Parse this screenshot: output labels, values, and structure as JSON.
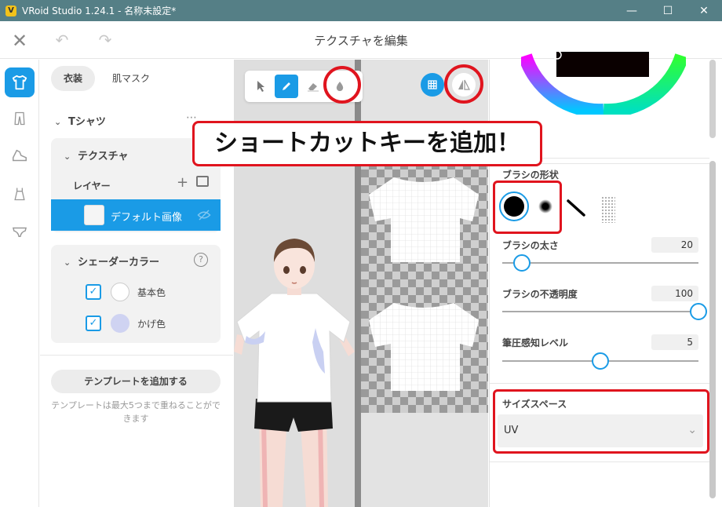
{
  "window": {
    "title": "VRoid Studio 1.24.1 - 名称未設定*",
    "logo_letter": "V",
    "controls": {
      "minimize": "—",
      "maximize": "☐",
      "close": "✕"
    }
  },
  "header": {
    "close": "✕",
    "undo": "↶",
    "redo": "↷",
    "title": "テクスチャを編集"
  },
  "rail": {
    "items": [
      "shirt-icon",
      "pants-icon",
      "shoe-icon",
      "dress-icon",
      "underwear-icon"
    ]
  },
  "left_panel": {
    "tabs": [
      "衣装",
      "肌マスク"
    ],
    "section_title": "Tシャツ",
    "texture_title": "テクスチャ",
    "layer_label": "レイヤー",
    "add_icon": "+",
    "selected_layer": "デフォルト画像",
    "shader_title": "シェーダーカラー",
    "help": "?",
    "colors": [
      {
        "label": "基本色",
        "swatch": "#ffffff",
        "checked": "✓"
      },
      {
        "label": "かげ色",
        "swatch": "#cfd3f2",
        "checked": "✓"
      }
    ],
    "add_template": "テンプレートを追加する",
    "template_note": "テンプレートは最大5つまで重ねることができます"
  },
  "callout": "ショートカットキーを追加！",
  "right_panel": {
    "brush_shape_label": "ブラシの形状",
    "brush_size_label": "ブラシの太さ",
    "brush_size_value": "20",
    "brush_size_level": 0.1,
    "brush_opacity_label": "ブラシの不透明度",
    "brush_opacity_value": "100",
    "brush_opacity_level": 1.0,
    "pressure_label": "筆圧感知レベル",
    "pressure_value": "5",
    "pressure_level": 0.5,
    "size_space_label": "サイズスペース",
    "size_space_value": "UV",
    "select_chevron": "⌄"
  },
  "colors": {
    "accent": "#1a9be6",
    "titlebar": "#557f86",
    "highlight": "#e0141e"
  }
}
